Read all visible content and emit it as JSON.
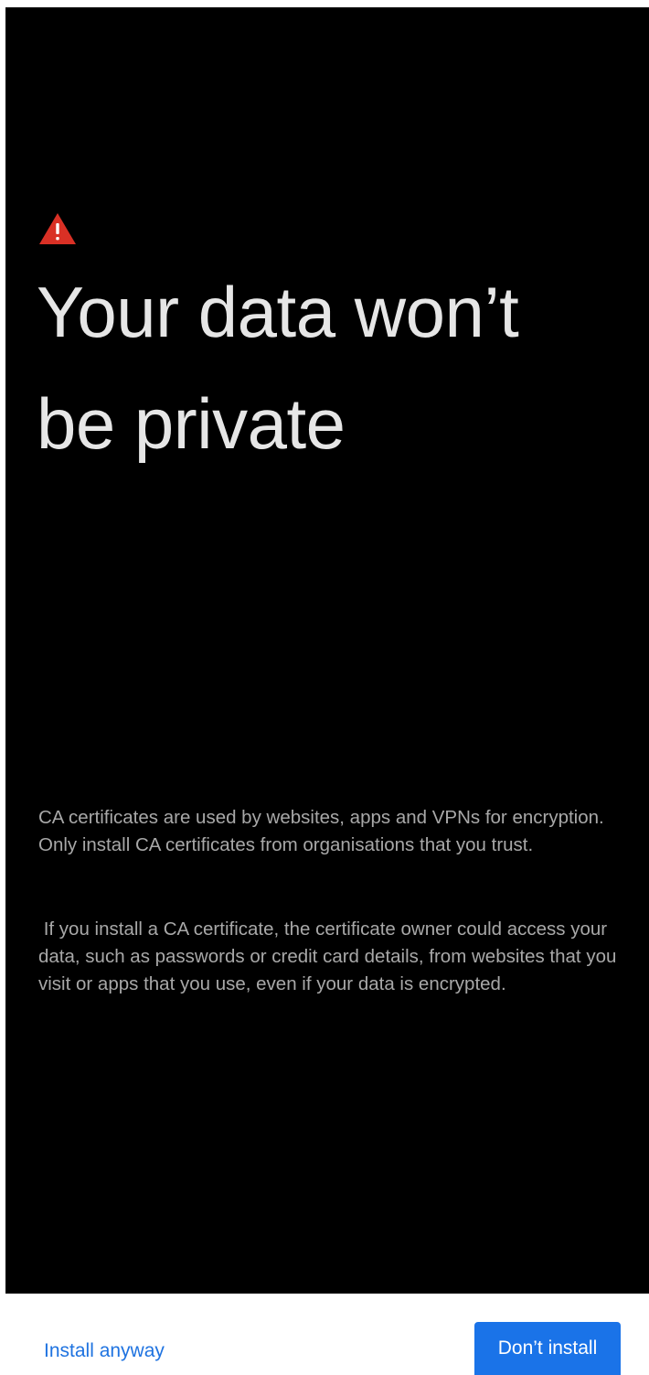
{
  "dialog": {
    "icon": "warning-triangle-icon",
    "icon_color": "#d93025",
    "title": "Your data won’t be private",
    "paragraphs": [
      "CA certificates are used by websites, apps and VPNs for encryption. Only install CA certificates from organisations that you trust.",
      " If you install a CA certificate, the certificate owner could access your data, such as passwords or credit card details, from websites that you visit or apps that you use, even if your data is encrypted."
    ]
  },
  "actions": {
    "secondary_label": "Install anyway",
    "primary_label": "Don’t install",
    "accent_color": "#1a73e8"
  }
}
